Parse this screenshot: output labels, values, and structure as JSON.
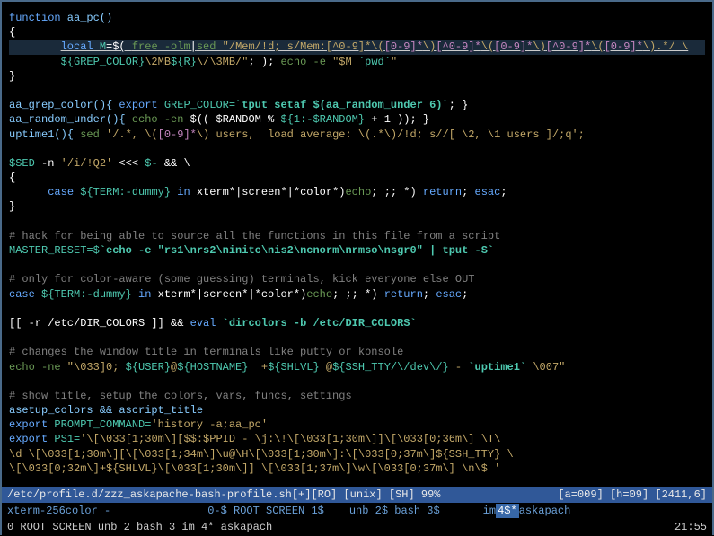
{
  "code": {
    "l1_kw": "function",
    "l1_name": " aa_pc()",
    "l2": "{",
    "l3a": "        ",
    "l3b": "local",
    "l3c": " M",
    "l3d": "=$( ",
    "l3e": "free -olm",
    "l3f": "|",
    "l3g": "sed",
    "l3h": " \"/Mem/!d; s/Mem:[^0-9]*\\(",
    "l3i": "[0-9]*",
    "l3j": "\\)",
    "l3k": "[^0-9]*",
    "l3l": "\\(",
    "l3m": "[0-9]*",
    "l3n": "\\)",
    "l3o": "[^0-9]*",
    "l3p": "\\(",
    "l3q": "[0-9]*",
    "l3r": "\\).*/ \\",
    "l4a": "        ${GREP_COLOR}",
    "l4b": "\\2MB",
    "l4c": "${R}",
    "l4d": "\\/\\3MB/\"",
    "l4e": "; ); ",
    "l4f": "echo -e",
    "l4g": " \"$M ",
    "l4h": "`pwd`",
    "l4i": "\"",
    "l5": "}",
    "l7a": "aa_grep_color(){ ",
    "l7b": "export",
    "l7c": " GREP_COLOR=",
    "l7d": "`tput setaf $(aa_random_under 6)`",
    "l7e": "; }",
    "l8a": "aa_random_under(){ ",
    "l8b": "echo -en",
    "l8c": " $(( $RANDOM % ",
    "l8d": "${1:-$RANDOM}",
    "l8e": " + 1 )); }",
    "l9a": "uptime1(){ ",
    "l9b": "sed",
    "l9c": " '/.*, \\(",
    "l9d": "[0-9]*",
    "l9e": "\\) users,  load average: \\(.*\\)/!d; s//[ \\2, \\1 users ]/;q';",
    "l11a": "$SED",
    "l11b": " -n ",
    "l11c": "'/i/!Q2'",
    "l11d": " <<< ",
    "l11e": "$-",
    "l11f": " && \\",
    "l12": "{",
    "l13a": "      ",
    "l13b": "case",
    "l13c": " ${TERM:-dummy} ",
    "l13d": "in",
    "l13e": " xterm*|screen*|*color*)",
    "l13f": "echo",
    "l13g": "; ;; *) ",
    "l13h": "return",
    "l13i": "; ",
    "l13j": "esac",
    "l13k": ";",
    "l14": "}",
    "l16": "# hack for being able to source all the functions in this file from a script",
    "l17a": "MASTER_RESET=$",
    "l17b": "`echo -e \"rs1\\nrs2\\ninitc\\nis2\\ncnorm\\nrmso\\nsgr0\" | tput -S`",
    "l19": "# only for color-aware (some guessing) terminals, kick everyone else OUT",
    "l20a": "case",
    "l20b": " ${TERM:-dummy} ",
    "l20c": "in",
    "l20d": " xterm*|screen*|*color*)",
    "l20e": "echo",
    "l20f": "; ;; *) ",
    "l20g": "return",
    "l20h": "; ",
    "l20i": "esac",
    "l20j": ";",
    "l22a": "[[ -r /etc/DIR_COLORS ]] && ",
    "l22b": "eval",
    "l22c": " `dircolors -b /etc/DIR_COLORS`",
    "l24": "# changes the window title in terminals like putty or konsole",
    "l25a": "echo -ne",
    "l25b": " \"\\033]0; ",
    "l25c": "${USER}",
    "l25d": "@",
    "l25e": "${HOSTNAME}",
    "l25f": "  +",
    "l25g": "${SHLVL}",
    "l25h": " @",
    "l25i": "${SSH_TTY/\\/dev\\/}",
    "l25j": " - ",
    "l25k": "`uptime1`",
    "l25l": " \\007\"",
    "l27": "# show title, setup the colors, vars, funcs, settings",
    "l28": "asetup_colors && ascript_title",
    "l29a": "export",
    "l29b": " PROMPT_COMMAND=",
    "l29c": "'history -a;aa_pc'",
    "l30a": "export",
    "l30b": " PS1=",
    "l30c": "'\\[\\033[1;30m\\][$$:$PPID - \\j:\\!\\[\\033[1;30m\\]]\\[\\033[0;36m\\] \\T\\",
    "l31": "\\d \\[\\033[1;30m\\][\\[\\033[1;34m\\]\\u@\\H\\[\\033[1;30m\\]:\\[\\033[0;37m\\]${SSH_TTY} \\",
    "l32": "\\[\\033[0;32m\\]+${SHLVL}\\[\\033[1;30m\\]] \\[\\033[1;37m\\]\\w\\[\\033[0;37m\\] \\n\\$ '"
  },
  "status": {
    "left": "/etc/profile.d/zzz_askapache-bash-profile.sh[+][RO] [unix] [SH] 99%",
    "right": "[a=009] [h=09] [2411,6]"
  },
  "bar1": {
    "s1": "xterm-256color -",
    "s2": "0-$ ROOT SCREEN  1$",
    "s3": "unb  2$ bash  3$",
    "s4": "im  ",
    "s5a": "4$*",
    "s5b": " askapach"
  },
  "bar2": {
    "left": "0 ROOT SCREEN       unb  2 bash  3        im  4* askapach",
    "right": "21:55"
  }
}
